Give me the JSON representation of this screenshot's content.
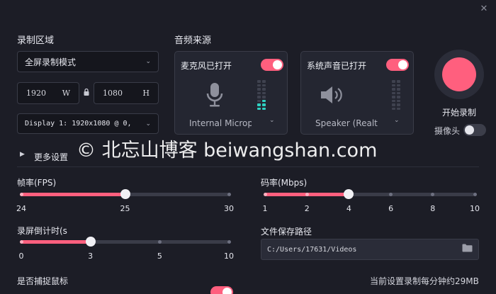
{
  "window": {
    "close_glyph": "✕"
  },
  "recording_area": {
    "title": "录制区域",
    "mode_select": "全屏录制模式",
    "width": "1920",
    "width_unit": "W",
    "height": "1080",
    "height_unit": "H",
    "display_select": "Display 1: 1920x1080 @ 0,"
  },
  "audio": {
    "title": "音频来源",
    "mic": {
      "title": "麦克风已打开",
      "device": "Internal Microp",
      "on": true,
      "level_fraction": 0.3
    },
    "system": {
      "title": "系统声音已打开",
      "device": "Speaker (Realte",
      "on": true,
      "level_fraction": 0.0
    }
  },
  "record": {
    "start_label": "开始录制",
    "camera_label": "摄像头",
    "camera_on": false
  },
  "more_settings": "更多设置",
  "watermark": "© 北忘山博客 beiwangshan.com",
  "sliders": {
    "fps": {
      "label": "帧率(FPS)",
      "ticks": [
        "24",
        "25",
        "30"
      ],
      "tick_values": [
        24,
        25,
        30
      ],
      "value": 25
    },
    "bitrate": {
      "label": "码率(Mbps)",
      "ticks": [
        "1",
        "2",
        "4",
        "6",
        "8",
        "10"
      ],
      "tick_values": [
        1,
        2,
        4,
        6,
        8,
        10
      ],
      "value": 4
    },
    "countdown": {
      "label": "录屏倒计时(s",
      "ticks": [
        "0",
        "3",
        "5",
        "10"
      ],
      "tick_values": [
        0,
        3,
        5,
        10
      ],
      "value": 3
    }
  },
  "save_path": {
    "label": "文件保存路径",
    "value": "C:/Users/17631/Videos"
  },
  "capture_cursor": {
    "label": "是否捕捉鼠标",
    "on": true
  },
  "estimate": "当前设置录制每分钟约29MB",
  "colors": {
    "accent": "#ff5f7e",
    "meter": "#2fd0c1",
    "background": "#1c1d26"
  }
}
